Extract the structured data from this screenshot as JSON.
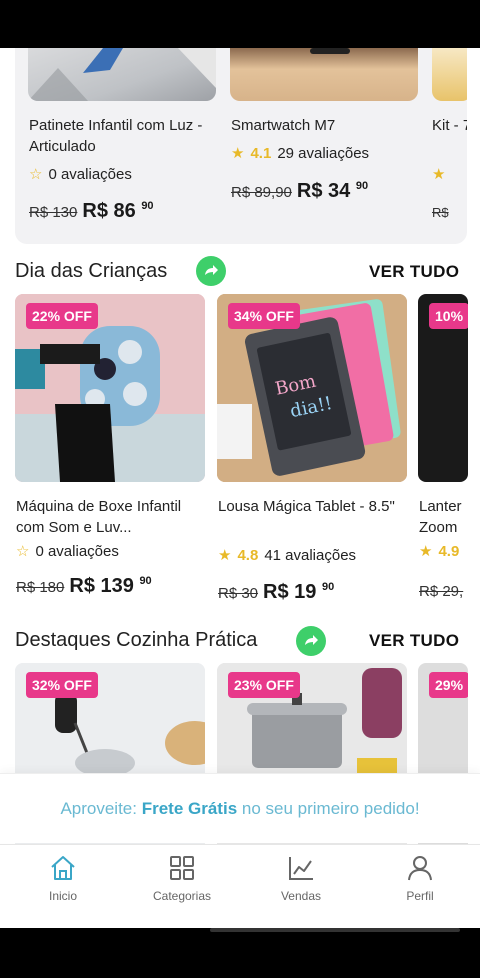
{
  "top_products": [
    {
      "title": "Patinete Infantil com Luz - Articulado",
      "rating_text": "0 avaliações",
      "rating_value": "",
      "old_price": "R$ 130",
      "price_main": "R$ 86",
      "price_cents": "90"
    },
    {
      "title": "Smartwatch M7",
      "rating_value": "4.1",
      "rating_text": "29 avaliações",
      "old_price": "R$ 89,90",
      "price_main": "R$ 34",
      "price_cents": "90"
    },
    {
      "title": "Kit - 7",
      "rating_value": "",
      "rating_text": "",
      "old_price": "R$",
      "price_main": "",
      "price_cents": ""
    }
  ],
  "section_kids": {
    "title": "Dia das Crianças",
    "ver_tudo": "VER TUDO",
    "products": [
      {
        "discount": "22% OFF",
        "title": "Máquina de Boxe Infantil com Som e Luv...",
        "rating_value": "",
        "rating_text": "0 avaliações",
        "old_price": "R$ 180",
        "price_main": "R$ 139",
        "price_cents": "90"
      },
      {
        "discount": "34% OFF",
        "title": "Lousa Mágica Tablet - 8.5\"",
        "rating_value": "4.8",
        "rating_text": "41 avaliações",
        "old_price": "R$ 30",
        "price_main": "R$ 19",
        "price_cents": "90"
      },
      {
        "discount": "10%",
        "title": "Lanter Zoom",
        "rating_value": "4.9",
        "rating_text": "",
        "old_price": "R$ 29,",
        "price_main": "",
        "price_cents": ""
      }
    ]
  },
  "section_kitchen": {
    "title": "Destaques Cozinha Prática",
    "ver_tudo": "VER TUDO",
    "products": [
      {
        "discount": "32% OFF"
      },
      {
        "discount": "23% OFF"
      },
      {
        "discount": "29%"
      }
    ]
  },
  "promo": {
    "prefix": "Aproveite:",
    "highlight": "Frete Grátis",
    "suffix": "no seu primeiro pedido!"
  },
  "tabs": [
    {
      "label": "Inicio",
      "icon": "home-icon"
    },
    {
      "label": "Categorias",
      "icon": "grid-icon"
    },
    {
      "label": "Vendas",
      "icon": "chart-icon"
    },
    {
      "label": "Perfil",
      "icon": "user-icon"
    }
  ],
  "colors": {
    "accent": "#e8388a",
    "green": "#3ecf6a",
    "promo": "#3aa6c7",
    "star": "#e8b928"
  }
}
